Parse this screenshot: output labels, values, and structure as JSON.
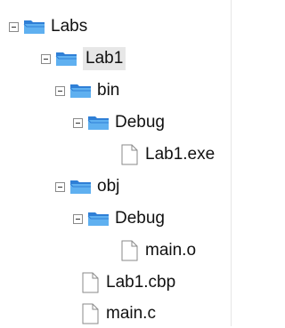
{
  "tree": {
    "root": {
      "label": "Labs",
      "children": {
        "lab1": {
          "label": "Lab1",
          "bin": {
            "label": "bin",
            "debug": {
              "label": "Debug",
              "file": "Lab1.exe"
            }
          },
          "obj": {
            "label": "obj",
            "debug": {
              "label": "Debug",
              "file": "main.o"
            }
          },
          "files": [
            "Lab1.cbp",
            "main.c"
          ]
        }
      }
    }
  },
  "icons": {
    "folder": "folder-icon",
    "file": "file-icon",
    "collapse": "collapse-toggle"
  },
  "colors": {
    "folder_blue": "#2f7fd6",
    "folder_light": "#5fb0f0"
  }
}
